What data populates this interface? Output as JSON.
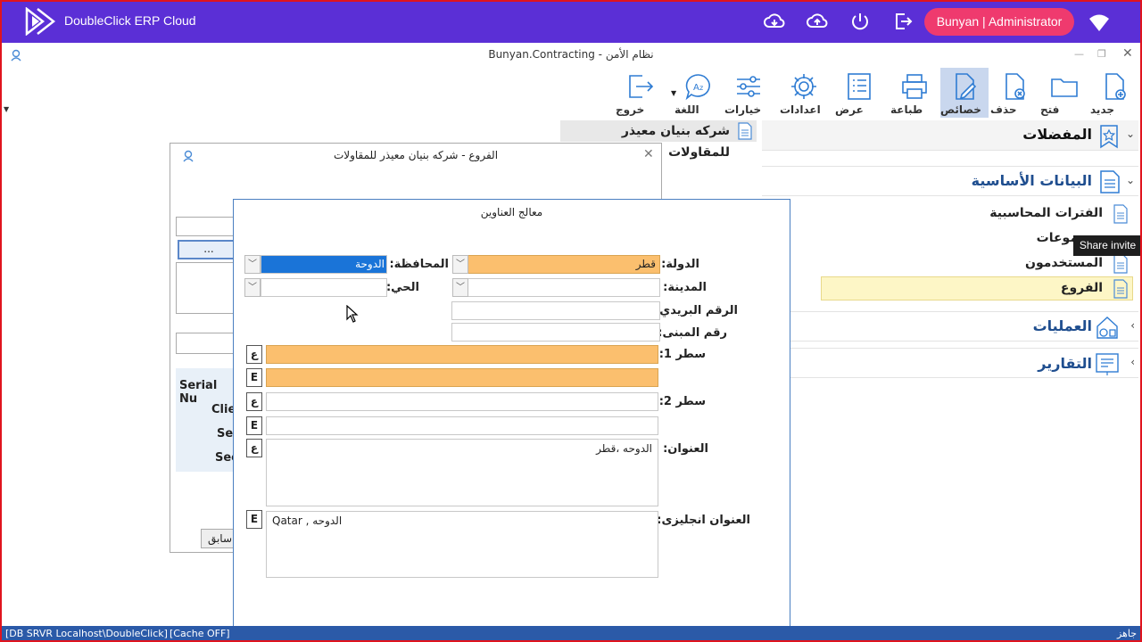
{
  "app": {
    "title": "DoubleClick ERP Cloud",
    "user": "Bunyan | Administrator"
  },
  "window": {
    "title": "Bunyan.Contracting - نظام الأمن"
  },
  "ribbon": {
    "new": "جديد",
    "open": "فتح",
    "delete": "حذف",
    "properties": "خصائص",
    "print": "طباعة",
    "view": "عرض",
    "settings": "اعدادات",
    "options": "خيارات",
    "language": "اللغة",
    "exit": "خروج"
  },
  "company_name": "شركه بنيان معيذر للمقاولات",
  "nav": {
    "favorites": "المفضلات",
    "basic_data": "البيانات الأساسية",
    "items": [
      "الفترات المحاسبية",
      "موعات",
      "المستخدمون",
      "الفروع"
    ],
    "operations": "العمليات",
    "reports": "التقارير"
  },
  "tooltip": "Share invite",
  "branches_dialog": {
    "title": "الفروع - شركه بنيان معيذر للمقاولات",
    "ellipsis": "...",
    "serial": "Serial Nu",
    "client": "Clie",
    "sec1": "Se",
    "sec2": "Sec",
    "prev": "سابق"
  },
  "wizard": {
    "title": "معالج العناوين",
    "country_label": "الدولة:",
    "country_value": "قطر",
    "province_label": "المحافظة:",
    "province_value": "الدوحة",
    "city_label": "المدينة:",
    "district_label": "الحي:",
    "postal_label": "الرقم البريدي:",
    "building_label": "رقم المبنى:",
    "line1_label": "سطر 1:",
    "line2_label": "سطر 2:",
    "address_label": "العنوان:",
    "address_value": "الدوحه ،قطر",
    "address_en_label": "العنوان انجليزى:",
    "address_en_value": "Qatar , الدوحه",
    "ar_btn": "ع",
    "en_btn": "E"
  },
  "status": {
    "db": "[DB SRVR Localhost\\DoubleClick]",
    "cache": "[Cache OFF]",
    "ready": "جاهز"
  }
}
